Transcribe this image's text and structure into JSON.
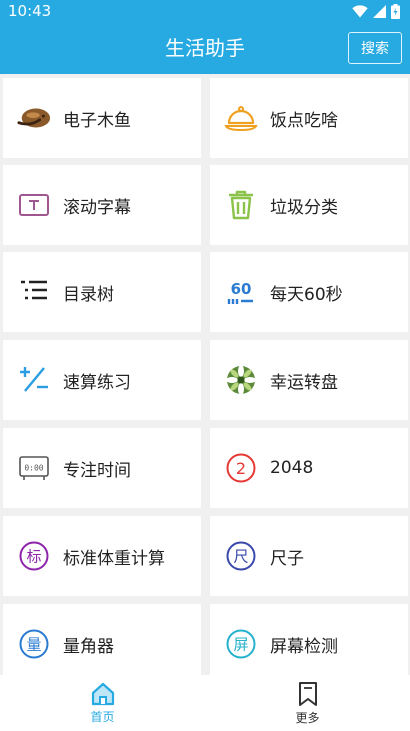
{
  "status": {
    "time": "10:43"
  },
  "header": {
    "title": "生活助手",
    "search_label": "搜索"
  },
  "tools": [
    {
      "label": "电子木鱼",
      "icon": "wooden-fish-icon"
    },
    {
      "label": "饭点吃啥",
      "icon": "food-cloche-icon"
    },
    {
      "label": "滚动字幕",
      "icon": "text-box-icon"
    },
    {
      "label": "垃圾分类",
      "icon": "trash-can-icon"
    },
    {
      "label": "目录树",
      "icon": "list-tree-icon"
    },
    {
      "label": "每天60秒",
      "icon": "sixty-seconds-icon",
      "icon_text": "60"
    },
    {
      "label": "速算练习",
      "icon": "plus-minus-icon"
    },
    {
      "label": "幸运转盘",
      "icon": "lucky-wheel-icon"
    },
    {
      "label": "专注时间",
      "icon": "clock-display-icon",
      "icon_text": "0:00"
    },
    {
      "label": "2048",
      "icon": "number-2-icon",
      "icon_text": "2"
    },
    {
      "label": "标准体重计算",
      "icon": "weight-badge-icon",
      "icon_text": "标"
    },
    {
      "label": "尺子",
      "icon": "ruler-badge-icon",
      "icon_text": "尺"
    },
    {
      "label": "量角器",
      "icon": "protractor-badge-icon",
      "icon_text": "量"
    },
    {
      "label": "屏幕检测",
      "icon": "screen-test-badge-icon",
      "icon_text": "屏"
    }
  ],
  "bottom_nav": [
    {
      "label": "首页",
      "icon": "home-icon",
      "active": true
    },
    {
      "label": "更多",
      "icon": "bookmark-icon",
      "active": false
    }
  ],
  "colors": {
    "primary": "#27aae1",
    "card_bg": "#ffffff",
    "page_bg": "#f0f0f0",
    "wheel_green": "#5a8a3a",
    "red": "#e53935",
    "purple": "#8e24aa",
    "indigo": "#3949ab",
    "blue": "#2a7bd1",
    "cyan": "#26b1cc",
    "trash_green": "#8bc34a",
    "fish_brown": "#8a5a2b"
  }
}
